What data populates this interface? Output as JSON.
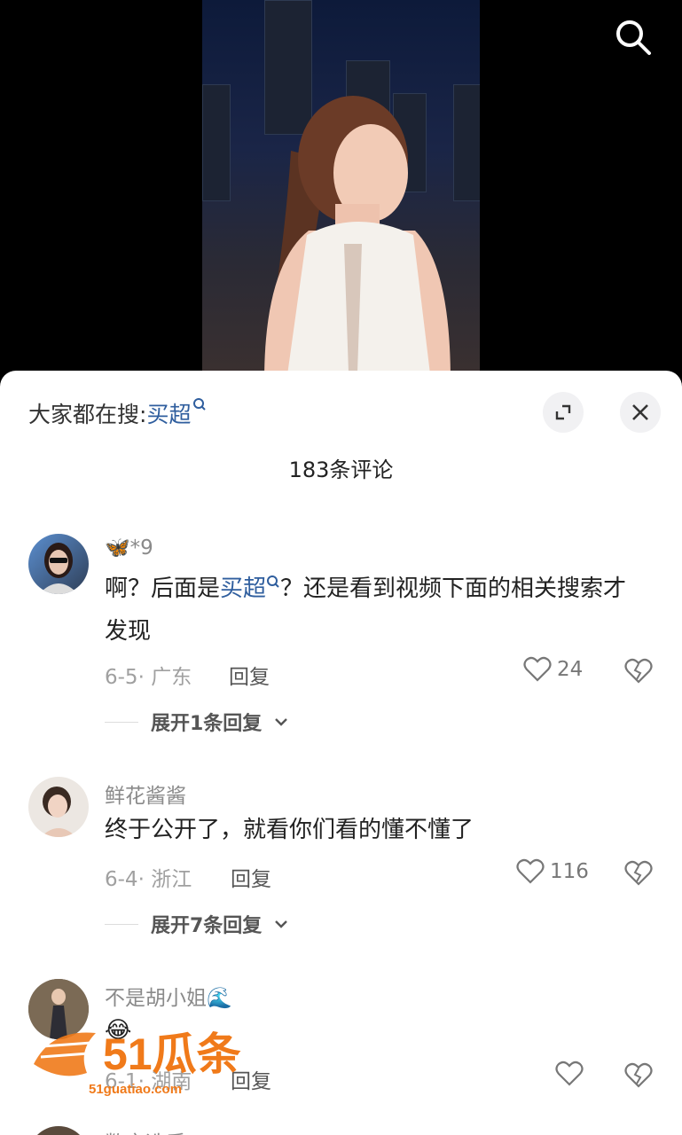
{
  "sheet": {
    "hot_prefix": "大家都在搜:",
    "hot_term": "买超",
    "comment_count": "183条评论"
  },
  "comments": [
    {
      "username": "🦋*9",
      "text": "啊？后面是",
      "text_term": "买超",
      "text_rest": "？还是看到视频下面的相关搜索才发现",
      "date_region": "6-5· 广东",
      "reply_label": "回复",
      "likes": "24",
      "expand": "展开1条回复"
    },
    {
      "username": "鲜花酱酱",
      "text": "终于公开了，就看你们看的懂不懂了",
      "date_region": "6-4· 浙江",
      "reply_label": "回复",
      "likes": "116",
      "expand": "展开7条回复"
    },
    {
      "username": "不是胡小姐🌊",
      "text": "😂",
      "date_region": "6-1· 湖南",
      "reply_label": "回复",
      "likes": ""
    },
    {
      "username": "数字选手"
    }
  ],
  "watermark": {
    "brand": "51瓜条",
    "url": "51guatiao.com"
  },
  "colors": {
    "accent": "#2f5e9e",
    "watermark": "#f07a1a"
  }
}
